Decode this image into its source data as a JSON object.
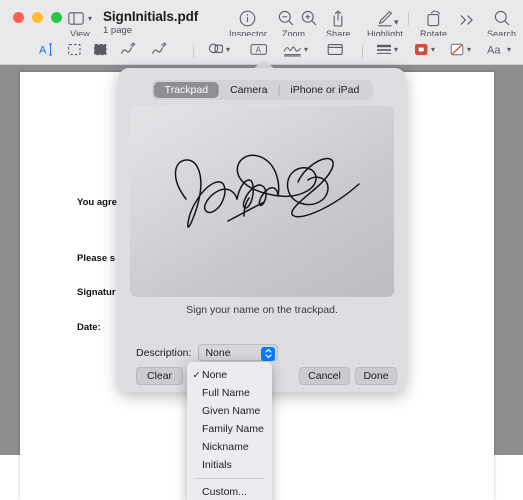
{
  "window": {
    "title": "SignInitials.pdf",
    "subtitle": "1 page",
    "traffic_lights": [
      "close",
      "minimize",
      "zoom"
    ]
  },
  "toolbar": {
    "view_label": "View",
    "inspector_label": "Inspector",
    "zoom_label": "Zoom",
    "share_label": "Share",
    "highlight_label": "Highlight",
    "rotate_label": "Rotate",
    "search_label": "Search",
    "icons": [
      "sidebar-icon",
      "chevron-down-icon",
      "info-circle-icon",
      "zoom-out-icon",
      "zoom-in-icon",
      "share-icon",
      "highlight-pen-icon",
      "rotate-icon",
      "more-chevrons-icon",
      "search-icon"
    ]
  },
  "toolbar2": {
    "icons": [
      "text-select-icon",
      "rectangular-selection-icon",
      "lasso-selection-icon",
      "redact-icon",
      "sketch-icon",
      "draw-icon",
      "shapes-icon",
      "text-box-icon",
      "signature-icon",
      "note-icon",
      "line-style-icon",
      "fill-color-icon",
      "stroke-color-icon",
      "font-icon"
    ]
  },
  "document": {
    "lines": [
      "You agre",
      "Please s",
      "Signatur",
      "Date:"
    ]
  },
  "popover": {
    "tabs": [
      {
        "label": "Trackpad",
        "active": true
      },
      {
        "label": "Camera",
        "active": false
      },
      {
        "label": "iPhone or iPad",
        "active": false
      }
    ],
    "hint": "Sign your name on the trackpad.",
    "description_label": "Description:",
    "description_value": "None",
    "clear_label": "Clear",
    "cancel_label": "Cancel",
    "done_label": "Done",
    "accent_color": "#0a7cf0",
    "background_color": "#dddde2"
  },
  "menu": {
    "checkmark": "✓",
    "items": [
      {
        "label": "None",
        "checked": true
      },
      {
        "label": "Full Name",
        "checked": false
      },
      {
        "label": "Given Name",
        "checked": false
      },
      {
        "label": "Family Name",
        "checked": false
      },
      {
        "label": "Nickname",
        "checked": false
      },
      {
        "label": "Initials",
        "checked": false
      }
    ],
    "custom_label": "Custom..."
  }
}
